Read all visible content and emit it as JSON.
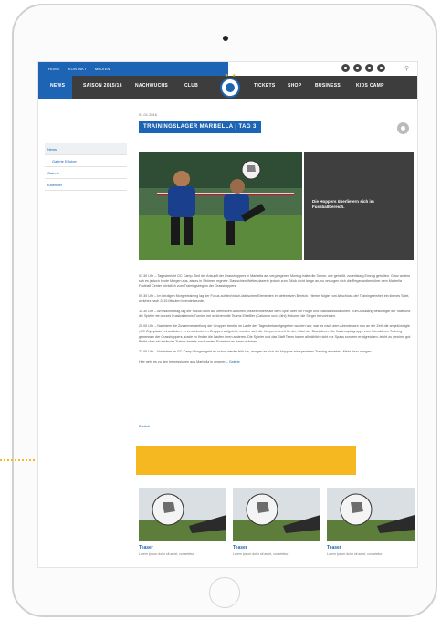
{
  "topbar": {
    "links": [
      "HOME",
      "KONTAKT",
      "MEDIEN"
    ],
    "search_icon": "search-icon"
  },
  "social_icons": [
    "facebook-icon",
    "twitter-icon",
    "youtube-icon",
    "instagram-icon"
  ],
  "nav": {
    "items": [
      "NEWS",
      "SAISON 2015/16",
      "NACHWUCHS",
      "CLUB",
      "TICKETS",
      "SHOP",
      "BUSINESS",
      "KIDS CAMP"
    ],
    "active": "NEWS"
  },
  "sidebar": {
    "items": [
      "News",
      "Galerie Erfolge",
      "Galerie",
      "Kalender"
    ]
  },
  "article": {
    "date": "01.01.2016",
    "title": "TRAININGSLAGER MARBELLA | TAG 3",
    "hero_caption": "Die Hoppers überliefern sich im Fussballbereich.",
    "paragraphs": [
      "07.30 Uhr – Tagesbericht GC Camp. Seit der Ankunft der Grasshoppers in Marbella am vergangenen Montag hatte die Sonne, wie geheißt, zuverlässig Einzug gehalten. Ganz anders sah es jedoch heute Morgen aus, als es in Strömen regnete. Das schien Weiter dazerte jedoch zum Glück nicht lange an, so verzogen sich die Regenwolken über dem Marbella Football Center pünktlich zum Trainingsbeginn der Grasshoppers.",
      "09.30 Uhr – Im heutigen Morgentraining lag der Fokus auf technisch-taktischen Elementen im defensiven Bereich. Hierbei folgte zum Abschluss der Trainingseinheit ein kleines Spiel, welches nach 2x15 Minuten beendet wurde.",
      "10.30 Uhr – Am Nachmittag lag der Fokus dann auf offensiven Aktionen, insbesondere auf dem Spiel über die Flügel und Standardsituationen. Zum Ausklang besichtigte der Staff und die Spieler ein kurzes Fussballtennis Turnier, bei welchem die Teams Eliteliller (Caluman und Lüthi) Kirkoner die Sieger hervortraten.",
      "20.00 Uhr – Nachdem die Zusammenstellung der Gruppen bereits im Laufe des Tages bekanntgegeben wurden war, war es nach dem Abendessen nun an der Zeit, die angekündigte „GC Olympiade“ einzuläuten. In verschiedenen Gruppen aufgeteilt, wurden sich die Hoppers bereit für den Start der Disziplinen: Die Kartenspielgruppe zum Interaktiven Training gemessen der Grasshoppers, sowie zu finden die Laufen ihren anderen. Die Spieler und das Staff Team haben allmählich nicht nur Spass sondern erfolgreichen, leicht zu gewinnt gut. Bleibt uber ein serlische Trainer bereits nach ersten Ruhetest an daren erfahren.",
      "22.00 Uhr – Nachdem im GC Camp Morgen geht es schon wieder früh los, morgen es sich die Hoppers ein spezielles Training erwarten, Mehr dazu morgen…"
    ],
    "gallery_text": "Hier geht es zu den Impressionen aus Marbella in unserer –",
    "gallery_link": "Galerie",
    "back": "Zurück"
  },
  "teasers": [
    {
      "title": "Teaser",
      "text": "Lorem ipsum dolor sit amet, consetetur"
    },
    {
      "title": "Teaser",
      "text": "Lorem ipsum dolor sit amet, consetetur"
    },
    {
      "title": "Teaser",
      "text": "Lorem ipsum dolor sit amet, consetetur"
    }
  ],
  "colors": {
    "brand_blue": "#1d64b4",
    "nav_dark": "#3d3d3d",
    "banner_yellow": "#f6b820"
  }
}
